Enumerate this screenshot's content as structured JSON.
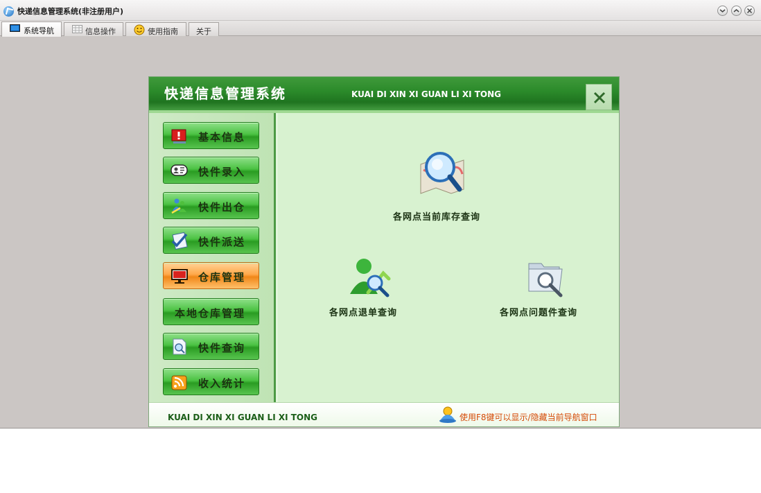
{
  "window": {
    "title": "快递信息管理系统(非注册用户)"
  },
  "tabs": [
    {
      "label": "系统导航",
      "icon": "monitor-icon",
      "active": true
    },
    {
      "label": "信息操作",
      "icon": "grid-icon",
      "active": false
    },
    {
      "label": "使用指南",
      "icon": "smiley-icon",
      "active": false
    },
    {
      "label": "关于",
      "icon": "",
      "active": false
    }
  ],
  "panel": {
    "title": "快递信息管理系统",
    "title_reflection": "快递信息管理系统",
    "subtitle": "KUAI DI XIN XI GUAN LI XI TONG",
    "close_icon": "close-icon",
    "accent_color": "#2b8a2a",
    "selected_color": "#f08718"
  },
  "sidebar": {
    "items": [
      {
        "label": "基本信息",
        "icon": "alert-monitor-icon"
      },
      {
        "label": "快件录入",
        "icon": "contact-card-icon"
      },
      {
        "label": "快件出仓",
        "icon": "people-arrow-icon"
      },
      {
        "label": "快件派送",
        "icon": "checklist-icon"
      },
      {
        "label": "仓库管理",
        "icon": "monitor-icon",
        "selected": true
      },
      {
        "label": "本地仓库管理",
        "icon": ""
      },
      {
        "label": "快件查询",
        "icon": "document-search-icon"
      },
      {
        "label": "收入统计",
        "icon": "rss-icon"
      }
    ]
  },
  "features": [
    {
      "label": "各网点当前库存查询",
      "icon": "map-search-icon"
    },
    {
      "label": "各网点退单查询",
      "icon": "user-search-icon"
    },
    {
      "label": "各网点问题件查询",
      "icon": "folder-search-icon"
    }
  ],
  "footer": {
    "left_text": "KUAI DI XIN XI GUAN LI XI TONG",
    "tip": "使用F8键可以显示/隐藏当前导航窗口",
    "tip_icon": "user-tip-icon"
  }
}
